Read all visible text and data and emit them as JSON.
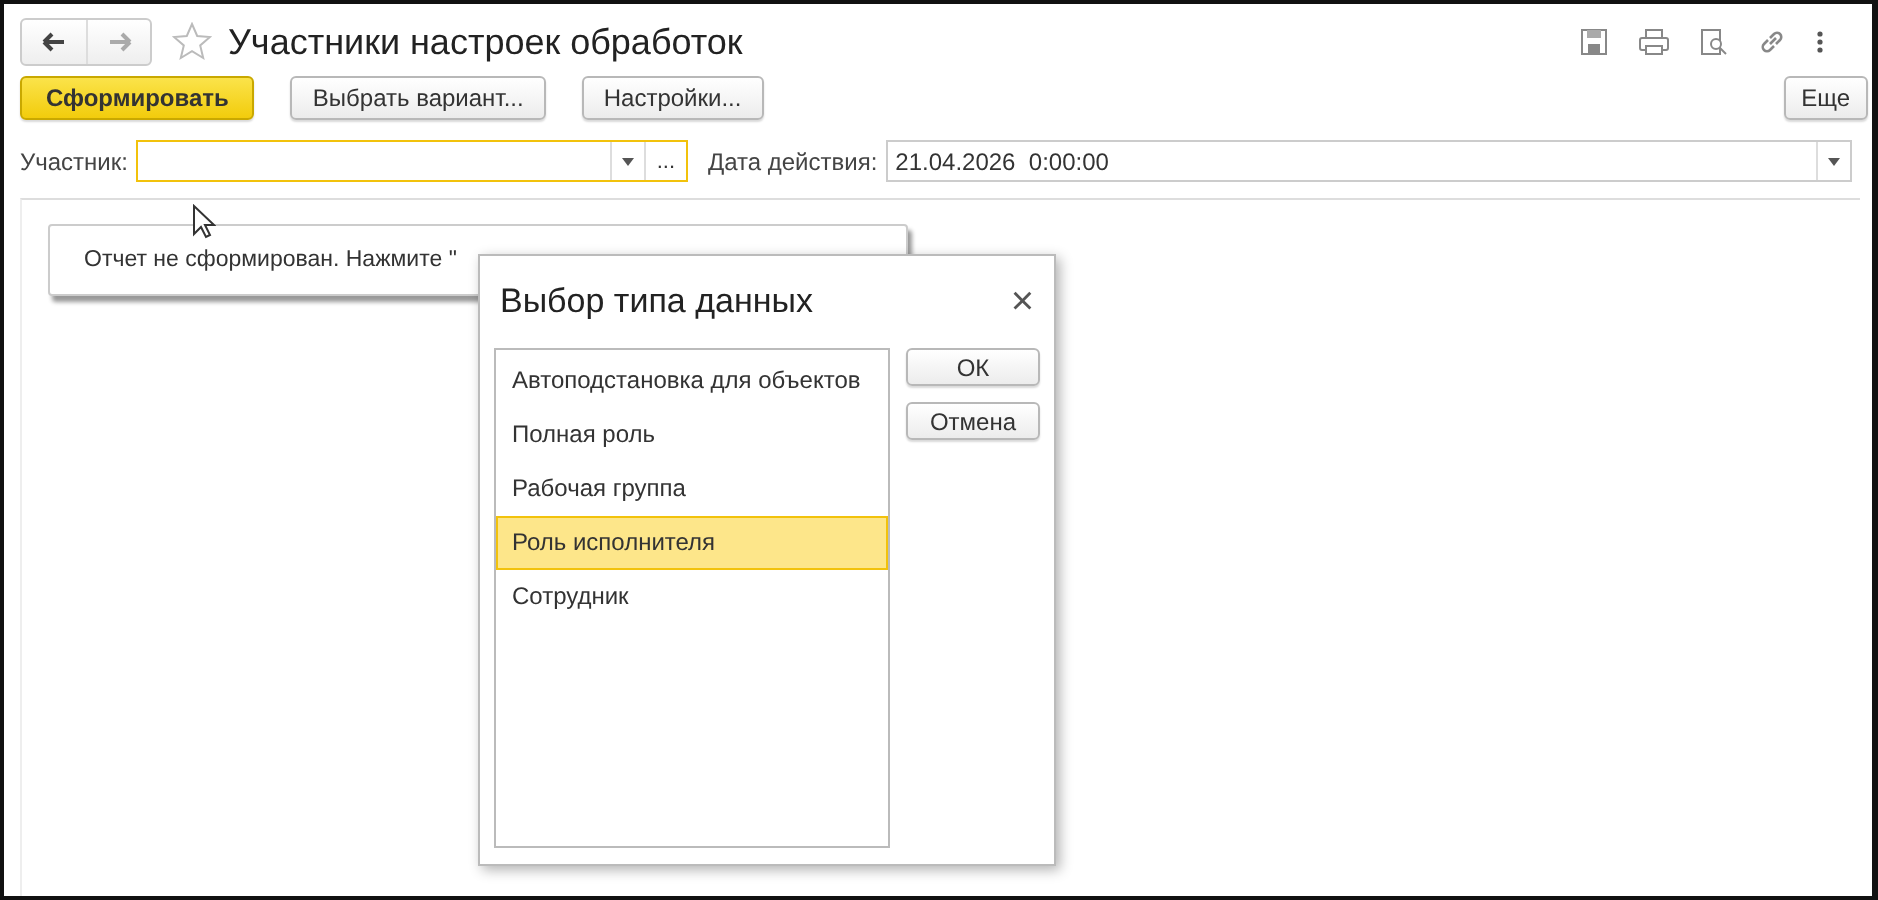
{
  "window": {
    "title": "Участники настроек обработок",
    "favorite": false
  },
  "toolbar": {
    "buttons": [
      {
        "label": "Сформировать",
        "kind": "primary"
      },
      {
        "label": "Выбрать вариант...",
        "kind": "normal"
      },
      {
        "label": "Настройки...",
        "kind": "normal"
      }
    ],
    "more": "Еще"
  },
  "filters": {
    "participant": {
      "label": "Участник:",
      "pick": "..."
    },
    "date": {
      "label": "Дата действия:",
      "value": "21.04.2026  0:00:00"
    }
  },
  "notice": "Отчет не сформирован. Нажмите \"",
  "dialog": {
    "title": "Выбор типа данных",
    "close": "×",
    "items": [
      {
        "label": "Автоподстановка для объектов",
        "selected": false
      },
      {
        "label": "Полная роль",
        "selected": false
      },
      {
        "label": "Рабочая группа",
        "selected": false
      },
      {
        "label": "Роль исполнителя",
        "selected": true
      },
      {
        "label": "Сотрудник",
        "selected": false
      }
    ],
    "buttons": [
      "ОК",
      "Отмена"
    ]
  }
}
